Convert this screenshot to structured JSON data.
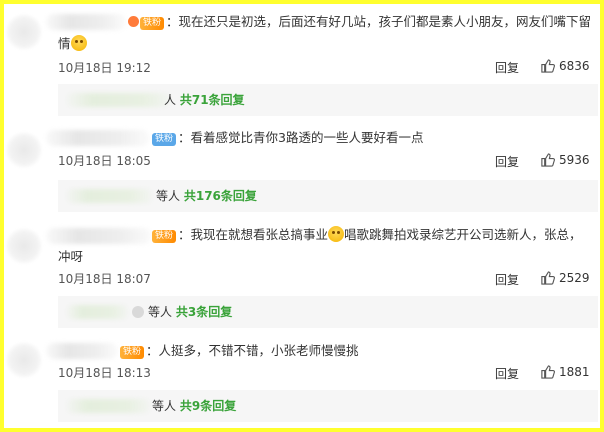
{
  "comments": [
    {
      "badge": "铁粉",
      "text": "：现在还只是初选，后面还有好几站，孩子们都是素人小朋友，网友们嘴下留",
      "text2": "情",
      "time": "10月18日 19:12",
      "reply_label": "回复",
      "likes": "6836",
      "replies_suffix": "人",
      "replies_count": "共71条回复"
    },
    {
      "badge": "铁粉",
      "text": "：看着感觉比青你3路透的一些人要好看一点",
      "time": "10月18日 18:05",
      "reply_label": "回复",
      "likes": "5936",
      "replies_suffix": "等人",
      "replies_count": "共176条回复"
    },
    {
      "badge": "铁粉",
      "text": "：我现在就想看张总搞事业",
      "text_mid": "唱歌跳舞拍戏录综艺开公司选新人，张总，",
      "text2": "冲呀",
      "time": "10月18日 18:07",
      "reply_label": "回复",
      "likes": "2529",
      "replies_suffix": "等人",
      "replies_count": "共3条回复"
    },
    {
      "badge": "铁粉",
      "text": "：人挺多，不错不错，小张老师慢慢挑",
      "time": "10月18日 18:13",
      "reply_label": "回复",
      "likes": "1881",
      "replies_suffix": "等人",
      "replies_count": "共9条回复"
    }
  ],
  "colors": {
    "frame": "#ffff2e",
    "reply_count": "#3aa33a",
    "badge_orange": "#ff8a00",
    "badge_blue": "#5aa7e8"
  },
  "icons": {
    "like": "thumbs-up-icon",
    "emoji": "smile-emoji-icon"
  }
}
